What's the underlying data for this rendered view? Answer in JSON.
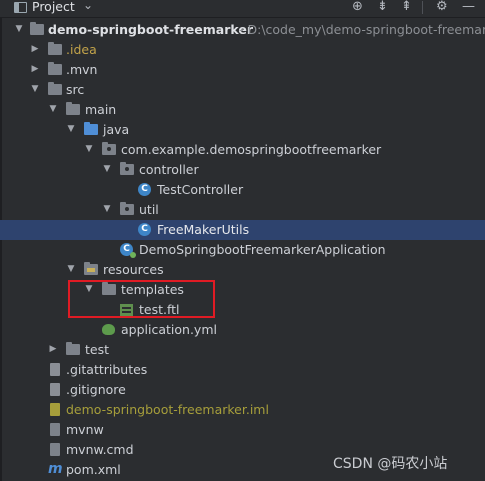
{
  "header": {
    "title": "Project",
    "icons": [
      "project-view-icon",
      "chevron-down-icon",
      "crosshair-icon",
      "expand-all-icon",
      "collapse-all-icon",
      "gear-icon",
      "minimize-icon"
    ]
  },
  "tree": {
    "root": {
      "name": "demo-springboot-freemarker",
      "path": "- D:\\code_my\\demo-springboot-freemarke"
    },
    "idea": ".idea",
    "mvn": ".mvn",
    "src": "src",
    "main": "main",
    "java": "java",
    "package": "com.example.demospringbootfreemarker",
    "controller": "controller",
    "test_controller": "TestController",
    "util": "util",
    "freemaker_utils": "FreeMakerUtils",
    "application_class": "DemoSpringbootFreemarkerApplication",
    "resources": "resources",
    "templates": "templates",
    "test_ftl": "test.ftl",
    "application_yml": "application.yml",
    "test": "test",
    "gitattributes": ".gitattributes",
    "gitignore": ".gitignore",
    "iml": "demo-springboot-freemarker.iml",
    "mvnw": "mvnw",
    "mvnw_cmd": "mvnw.cmd",
    "pom": "pom.xml"
  },
  "watermark": "CSDN @码农小站",
  "colors": {
    "background": "#2b2d30",
    "selection": "#2e436e",
    "folder_blue": "#4f8ed6",
    "excluded_orange": "#c2a34a",
    "highlight_box": "#e01b24"
  }
}
